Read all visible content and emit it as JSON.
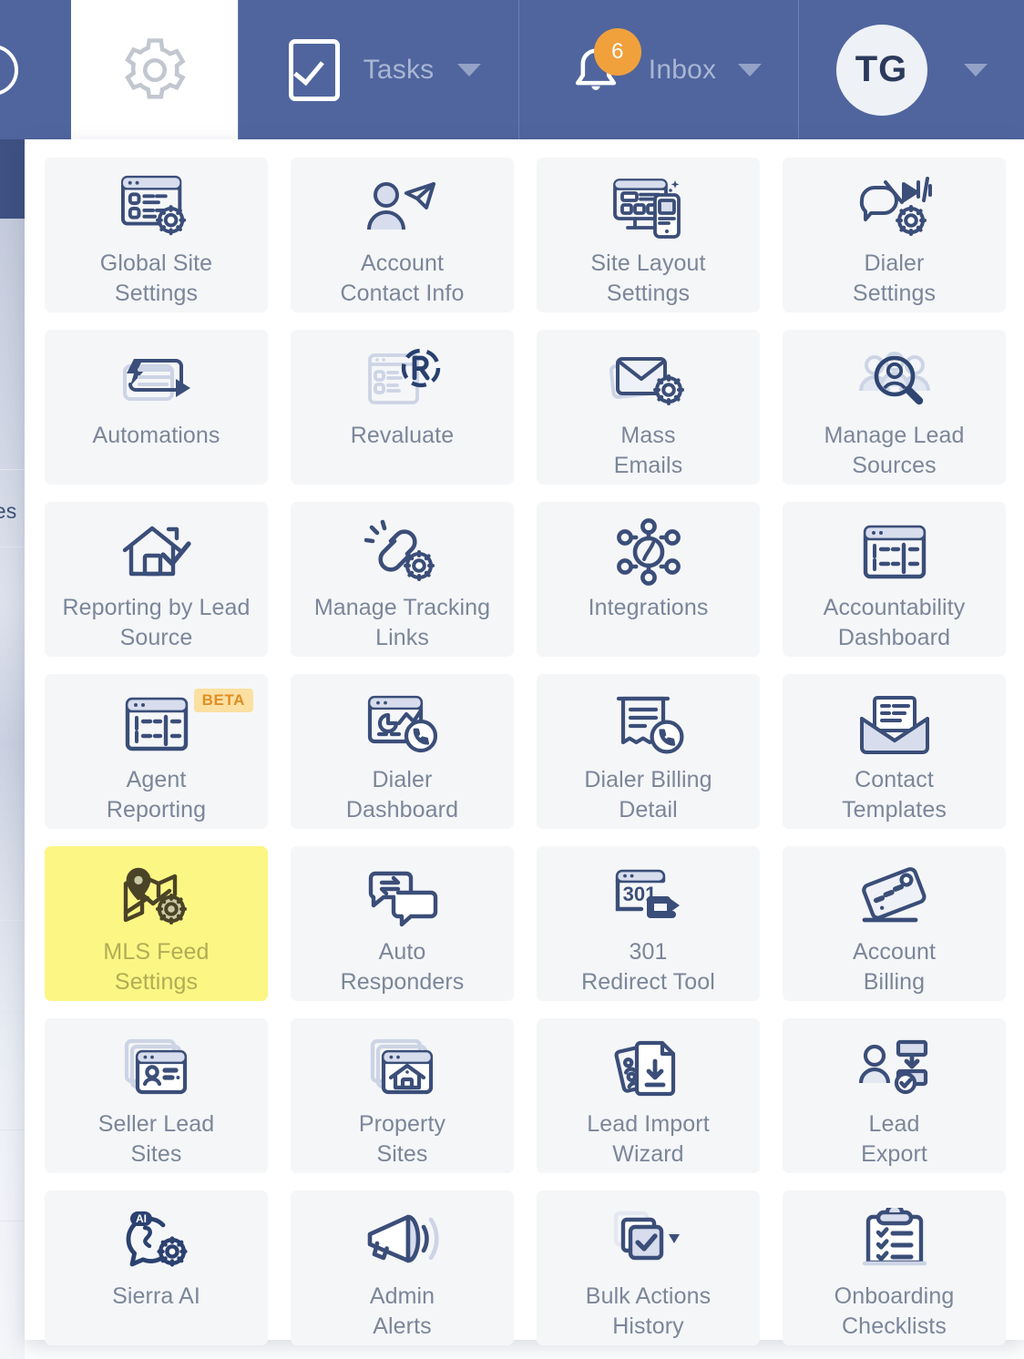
{
  "navbar": {
    "background_color": "#50659e",
    "left_partial_icon": "circle-partial-icon",
    "gear_tab": {
      "icon": "gear-icon",
      "active": true
    },
    "tasks": {
      "label": "Tasks",
      "icon": "checkbox-check-icon",
      "caret": "chevron-down-icon"
    },
    "inbox": {
      "label": "Inbox",
      "icon": "bell-icon",
      "badge_count": "6",
      "badge_color": "#f0a13c",
      "caret": "chevron-down-icon"
    },
    "user": {
      "initials": "TG",
      "caret": "chevron-down-icon"
    }
  },
  "background_page": {
    "snippet_text": "ses"
  },
  "dropdown": {
    "highlight_color": "#fcf684",
    "beta_label": "BETA",
    "items": [
      {
        "label_line1": "Global Site",
        "label_line2": "Settings",
        "icon": "site-settings-icon"
      },
      {
        "label_line1": "Account",
        "label_line2": "Contact Info",
        "icon": "account-contact-icon"
      },
      {
        "label_line1": "Site Layout",
        "label_line2": "Settings",
        "icon": "site-layout-icon"
      },
      {
        "label_line1": "Dialer",
        "label_line2": "Settings",
        "icon": "dialer-settings-icon"
      },
      {
        "label_line1": "Automations",
        "label_line2": "",
        "icon": "automations-icon"
      },
      {
        "label_line1": "Revaluate",
        "label_line2": "",
        "icon": "revaluate-icon"
      },
      {
        "label_line1": "Mass",
        "label_line2": "Emails",
        "icon": "mass-emails-icon"
      },
      {
        "label_line1": "Manage Lead",
        "label_line2": "Sources",
        "icon": "manage-lead-sources-icon"
      },
      {
        "label_line1": "Reporting by Lead",
        "label_line2": "Source",
        "icon": "reporting-lead-source-icon"
      },
      {
        "label_line1": "Manage Tracking",
        "label_line2": "Links",
        "icon": "tracking-links-icon"
      },
      {
        "label_line1": "Integrations",
        "label_line2": "",
        "icon": "integrations-icon"
      },
      {
        "label_line1": "Accountability",
        "label_line2": "Dashboard",
        "icon": "accountability-icon"
      },
      {
        "label_line1": "Agent",
        "label_line2": "Reporting",
        "icon": "agent-reporting-icon",
        "badge": "BETA"
      },
      {
        "label_line1": "Dialer",
        "label_line2": "Dashboard",
        "icon": "dialer-dashboard-icon"
      },
      {
        "label_line1": "Dialer Billing",
        "label_line2": "Detail",
        "icon": "dialer-billing-icon"
      },
      {
        "label_line1": "Contact",
        "label_line2": "Templates",
        "icon": "contact-templates-icon"
      },
      {
        "label_line1": "MLS Feed",
        "label_line2": "Settings",
        "icon": "mls-feed-icon",
        "highlighted": true
      },
      {
        "label_line1": "Auto",
        "label_line2": "Responders",
        "icon": "auto-responders-icon"
      },
      {
        "label_line1": "301",
        "label_line2": "Redirect Tool",
        "icon": "redirect-301-icon"
      },
      {
        "label_line1": "Account",
        "label_line2": "Billing",
        "icon": "account-billing-icon"
      },
      {
        "label_line1": "Seller Lead",
        "label_line2": "Sites",
        "icon": "seller-lead-sites-icon"
      },
      {
        "label_line1": "Property",
        "label_line2": "Sites",
        "icon": "property-sites-icon"
      },
      {
        "label_line1": "Lead Import",
        "label_line2": "Wizard",
        "icon": "lead-import-icon"
      },
      {
        "label_line1": "Lead",
        "label_line2": "Export",
        "icon": "lead-export-icon"
      },
      {
        "label_line1": "Sierra AI",
        "label_line2": "",
        "icon": "sierra-ai-icon"
      },
      {
        "label_line1": "Admin",
        "label_line2": "Alerts",
        "icon": "admin-alerts-icon"
      },
      {
        "label_line1": "Bulk Actions",
        "label_line2": "History",
        "icon": "bulk-actions-icon"
      },
      {
        "label_line1": "Onboarding",
        "label_line2": "Checklists",
        "icon": "onboarding-checklists-icon"
      }
    ]
  }
}
